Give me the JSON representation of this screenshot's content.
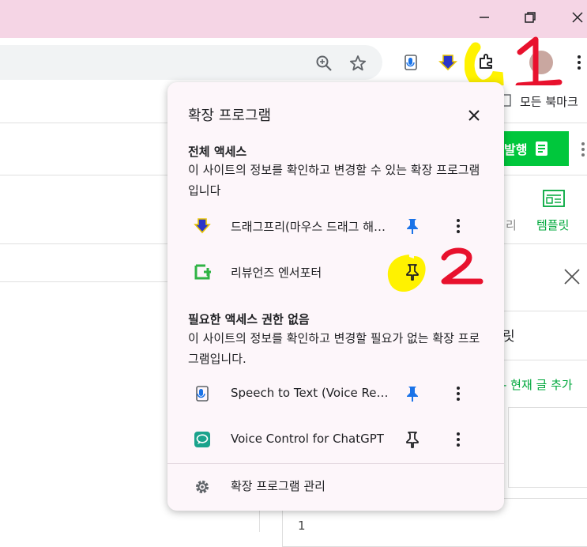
{
  "popup": {
    "title": "확장 프로그램",
    "full_access_heading": "전체 액세스",
    "full_access_desc": "이 사이트의 정보를 확인하고 변경할 수 있는 확장 프로그램입니다",
    "no_access_heading": "필요한 액세스 권한 없음",
    "no_access_desc": "이 사이트의 정보를 확인하고 변경할 필요가 없는 확장 프로그램입니다.",
    "extensions_full": [
      {
        "name": "드래그프리(마우스 드래그 해제)",
        "pinned": true,
        "icon": "drag-free-icon"
      },
      {
        "name": "리뷰언즈 엔서포터",
        "pinned": false,
        "icon": "reviewers-icon"
      }
    ],
    "extensions_none": [
      {
        "name": "Speech to Text (Voice Recognition)",
        "pinned": true,
        "icon": "speech-to-text-icon"
      },
      {
        "name": "Voice Control for ChatGPT",
        "pinned": false,
        "icon": "voice-control-icon"
      }
    ],
    "manage_label": "확장 프로그램 관리"
  },
  "page": {
    "bookmarks_label": "모든 북마크",
    "publish_label": "발행",
    "template_label": "템플릿",
    "partial_label_1": "리",
    "partial_tab_label": "릿",
    "add_current_label": "- 현재 글 추가",
    "line_number": "1"
  },
  "annotations": {
    "step1": "1",
    "step2": "2"
  },
  "colors": {
    "titlebar": "#f5d5e5",
    "accent_green": "#00c73c",
    "pin_blue": "#1a73e8",
    "highlight_yellow": "#fff200",
    "annotation_red": "#e8112d"
  }
}
